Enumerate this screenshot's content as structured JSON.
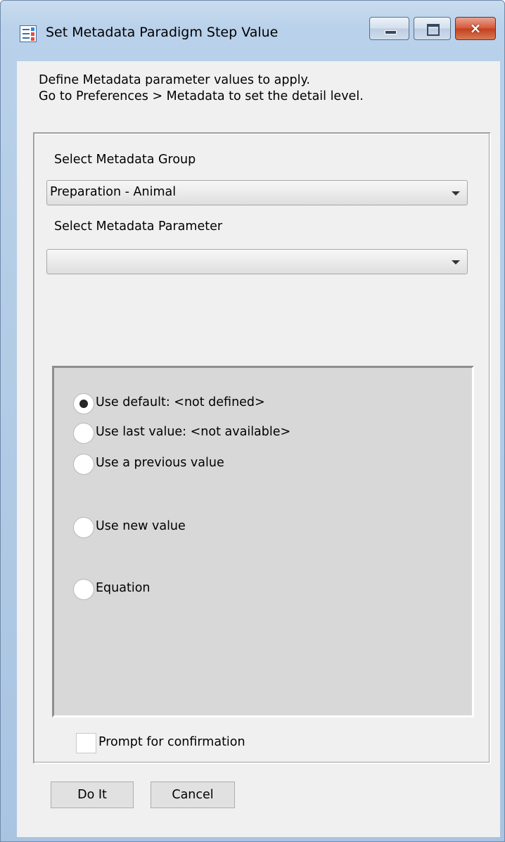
{
  "window": {
    "title": "Set Metadata Paradigm Step Value",
    "icon": "metadata-table-icon",
    "controls": {
      "minimize": "minimize-icon",
      "maximize": "maximize-icon",
      "close_glyph": "×"
    },
    "close_color": "#c3401f",
    "titlebar_color": "#b9d1ea"
  },
  "instructions": {
    "line1": "Define Metadata parameter values to apply.",
    "line2": "Go to Preferences > Metadata to set the detail level."
  },
  "group": {
    "label": "Select Metadata Group",
    "selected": "Preparation - Animal"
  },
  "parameter": {
    "label": "Select Metadata Parameter",
    "selected": ""
  },
  "options": [
    {
      "label": "Use default: <not defined>",
      "checked": true
    },
    {
      "label": "Use last value: <not available>",
      "checked": false
    },
    {
      "label": "Use a previous value",
      "checked": false
    },
    {
      "label": "Use new value",
      "checked": false
    },
    {
      "label": "Equation",
      "checked": false
    }
  ],
  "confirmation": {
    "label": "Prompt for confirmation",
    "checked": false
  },
  "buttons": {
    "do_it": "Do It",
    "cancel": "Cancel"
  }
}
